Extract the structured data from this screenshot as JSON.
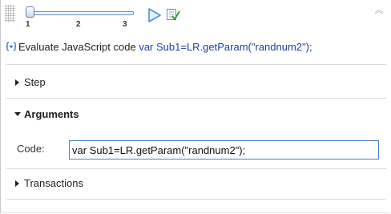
{
  "toolbar": {
    "slider_ticks": [
      "1",
      "2",
      "3"
    ],
    "slider_value": 1,
    "icons": {
      "grip": "drag-grip-icon",
      "run": "play-icon",
      "check": "checklist-icon",
      "collapse": "double-chevron-up-icon"
    }
  },
  "statement": {
    "icon": "javascript-step-icon",
    "label": "Evaluate JavaScript code",
    "code": "var Sub1=LR.getParam(\"randnum2\");"
  },
  "sections": {
    "step": {
      "label": "Step",
      "expanded": false
    },
    "arguments": {
      "label": "Arguments",
      "expanded": true
    },
    "transactions": {
      "label": "Transactions",
      "expanded": false
    }
  },
  "arguments": {
    "code_label": "Code:",
    "code_value": "var Sub1=LR.getParam(\"randnum2\");"
  },
  "colors": {
    "code_text": "#1a3ea8",
    "input_border": "#4a7ec2",
    "play_icon": "#4d8fe0"
  }
}
